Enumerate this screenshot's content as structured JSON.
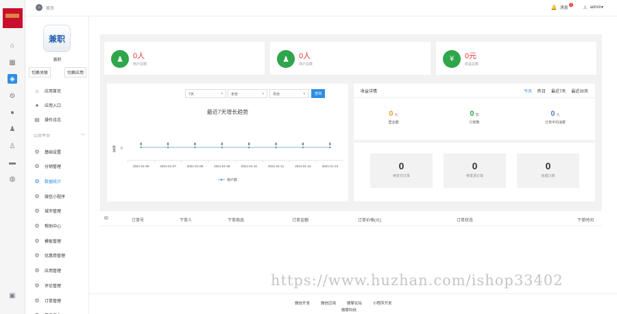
{
  "header": {
    "home_label": "首页",
    "message_label": "消息",
    "message_count": "2",
    "user_name": "admin▾"
  },
  "rail": {
    "icons": [
      "home-icon",
      "apps-icon",
      "cube-icon",
      "settings-icon",
      "data-icon",
      "team-icon",
      "user-icon",
      "monitor-icon",
      "globe-icon",
      "lock-icon"
    ]
  },
  "sidebar": {
    "app_name": "兼职",
    "app_logo_text": "兼职",
    "switch_app_label": "切换关联",
    "switch_app_btn": "切换应用",
    "top_items": [
      {
        "label": "应用首页",
        "icon": "home-icon"
      },
      {
        "label": "应用入口",
        "icon": "entry-icon"
      },
      {
        "label": "操作日志",
        "icon": "log-icon"
      }
    ],
    "group_title": "公共平台",
    "group_arrow": "﹀",
    "items": [
      {
        "label": "基础设置",
        "active": false
      },
      {
        "label": "分销管理",
        "active": false
      },
      {
        "label": "数据统计",
        "active": true
      },
      {
        "label": "微信小程序",
        "active": false
      },
      {
        "label": "城市管理",
        "active": false
      },
      {
        "label": "帮助中心",
        "active": false
      },
      {
        "label": "模板管理",
        "active": false
      },
      {
        "label": "优惠券管理",
        "active": false
      },
      {
        "label": "应用管理",
        "active": false
      },
      {
        "label": "评论管理",
        "active": false
      },
      {
        "label": "订单管理",
        "active": false
      },
      {
        "label": "用户中心",
        "active": false
      }
    ]
  },
  "stats": [
    {
      "value": "0人",
      "label": "用户总数",
      "icon": "user-icon"
    },
    {
      "value": "0人",
      "label": "商户总数",
      "icon": "merchant-icon"
    },
    {
      "value": "0元",
      "label": "收益总额",
      "icon": "money-icon"
    }
  ],
  "chart_filters": {
    "range": "7天",
    "start": "年份",
    "end": "月份",
    "arrow": "▾",
    "query": "查询"
  },
  "chart_data": {
    "type": "line",
    "title": "最近7天增长趋势",
    "ylabel": "数量",
    "categories": [
      "2021-01-06",
      "2021-01-07",
      "2021-01-08",
      "2021-01-09",
      "2021-01-10",
      "2021-01-11",
      "2021-01-12",
      "2021-01-13"
    ],
    "series": [
      {
        "name": "用户数",
        "values": [
          0,
          0,
          0,
          0,
          0,
          0,
          0,
          0
        ]
      }
    ],
    "y_tick": "0",
    "legend": "bottom",
    "color": "#5b9bd5"
  },
  "income": {
    "title": "收益详情",
    "tabs": [
      {
        "label": "今天",
        "on": true
      },
      {
        "label": "昨日",
        "on": false
      },
      {
        "label": "最近7天",
        "on": false
      },
      {
        "label": "最近30天",
        "on": false
      }
    ],
    "items": [
      {
        "value": "0",
        "unit": "元",
        "label": "营业额",
        "color": "#f0a030"
      },
      {
        "value": "0",
        "unit": "笔",
        "label": "订单数",
        "color": "#2fa64b"
      },
      {
        "value": "0",
        "unit": "元",
        "label": "订单平均消费",
        "color": "#5b7bd5"
      }
    ]
  },
  "orders": [
    {
      "value": "0",
      "label": "待支付订单"
    },
    {
      "value": "0",
      "label": "待发货订单"
    },
    {
      "value": "0",
      "label": "完成订单"
    }
  ],
  "table": {
    "headers": [
      "ID",
      "订单号",
      "下单人",
      "下单商品",
      "订单金额",
      "订单价格(元)",
      "订单状态",
      "下单时间"
    ]
  },
  "footer": {
    "links": [
      "微信开发",
      "微信应用",
      "微擎论坛",
      "小程序开发"
    ],
    "copyright": "微擎科技"
  },
  "watermark": "https://www.huzhan.com/ishop33402"
}
